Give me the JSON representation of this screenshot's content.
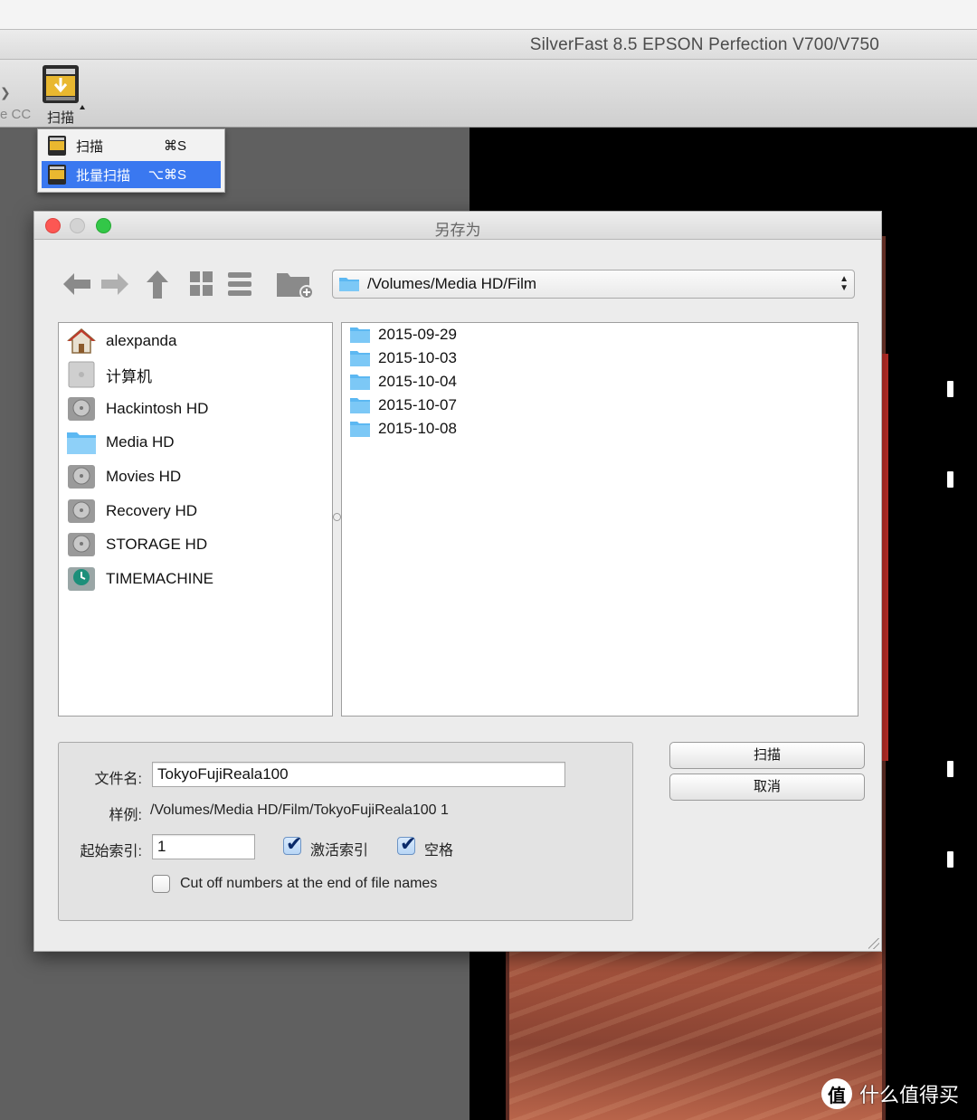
{
  "app": {
    "window_title": "SilverFast 8.5 EPSON Perfection V700/V750",
    "toolbar_prev_label_fragment": "e CC",
    "toolbar_scan_label": "扫描"
  },
  "scan_menu": {
    "items": [
      {
        "label": "扫描",
        "shortcut": "⌘S",
        "selected": false
      },
      {
        "label": "批量扫描",
        "shortcut": "⌥⌘S",
        "selected": true
      }
    ]
  },
  "save_dialog": {
    "title": "另存为",
    "path": "/Volumes/Media HD/Film",
    "sidebar": [
      {
        "label": "alexpanda",
        "icon": "home-icon"
      },
      {
        "label": "计算机",
        "icon": "computer-icon"
      },
      {
        "label": "Hackintosh HD",
        "icon": "harddisk-icon"
      },
      {
        "label": "Media HD",
        "icon": "folder-icon"
      },
      {
        "label": "Movies HD",
        "icon": "harddisk-icon"
      },
      {
        "label": "Recovery HD",
        "icon": "harddisk-icon"
      },
      {
        "label": "STORAGE HD",
        "icon": "harddisk-icon"
      },
      {
        "label": "TIMEMACHINE",
        "icon": "timemachine-icon"
      }
    ],
    "files": [
      {
        "name": "2015-09-29"
      },
      {
        "name": "2015-10-03"
      },
      {
        "name": "2015-10-04"
      },
      {
        "name": "2015-10-07"
      },
      {
        "name": "2015-10-08"
      }
    ],
    "filename_label": "文件名:",
    "filename_value": "TokyoFujiReala100",
    "example_label": "样例:",
    "example_value": "/Volumes/Media HD/Film/TokyoFujiReala100 1",
    "start_index_label": "起始索引:",
    "start_index_value": "1",
    "activate_index_label": "激活索引",
    "activate_index_checked": true,
    "space_label": "空格",
    "space_checked": true,
    "cutoff_label": "Cut off numbers at the end of file names",
    "cutoff_checked": false,
    "scan_button": "扫描",
    "cancel_button": "取消"
  },
  "watermark": {
    "logo_char": "值",
    "text": "什么值得买"
  },
  "colors": {
    "selection_blue": "#3a78f0",
    "folder_blue": "#5cb8f2",
    "close_red": "#fc5753",
    "zoom_green": "#33c748"
  }
}
